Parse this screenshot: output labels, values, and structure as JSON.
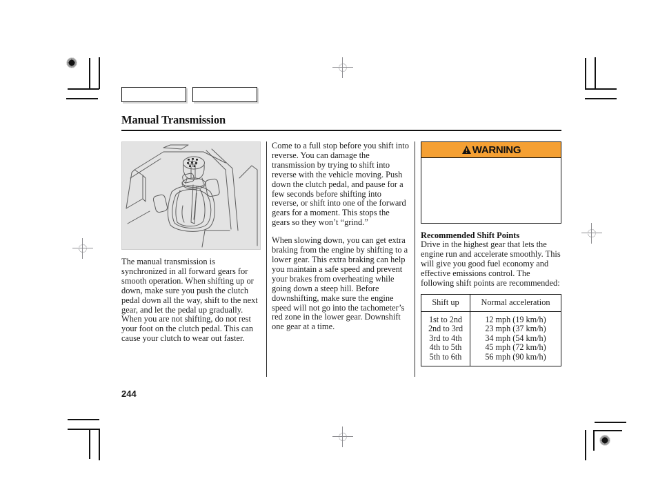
{
  "document": {
    "title": "Manual Transmission",
    "page_number": "244",
    "tabs": [
      {
        "label": ""
      },
      {
        "label": ""
      }
    ]
  },
  "figure": {
    "name": "manual-shift-lever-illustration",
    "alt": "Illustration of a manual transmission shift lever in the center console"
  },
  "left_column": {
    "caption": "The manual transmission is synchronized in all forward gears for smooth operation. When shifting up or down, make sure you push the clutch pedal down all the way, shift to the next gear, and let the pedal up gradually. When you are not shifting, do not rest your foot on the clutch pedal. This can cause your clutch to wear out faster."
  },
  "middle_column": {
    "paragraphs": [
      "Come to a full stop before you shift into reverse. You can damage the transmission by trying to shift into reverse with the vehicle moving. Push down the clutch pedal, and pause for a few seconds before shifting into reverse, or shift into one of the forward gears for a moment. This stops the gears so they won’t “grind.”",
      "When slowing down, you can get extra braking from the engine by shifting to a lower gear. This extra braking can help you maintain a safe speed and prevent your brakes from overheating while going down a steep hill. Before downshifting, make sure the engine speed will not go into the tachometer’s red zone in the lower gear. Downshift one gear at a time."
    ]
  },
  "right_column": {
    "warning": {
      "icon": "warning-triangle-icon",
      "label": "WARNING",
      "body": "",
      "header_color": "#f5a033"
    },
    "shift_points": {
      "heading": "Recommended Shift Points",
      "text": "Drive in the highest gear that lets the engine run and accelerate smoothly. This will give you good fuel economy and effective emissions control. The following shift points are recommended:",
      "table": {
        "headers": [
          "Shift up",
          "Normal acceleration"
        ],
        "rows": [
          [
            "1st to 2nd",
            "12 mph (19 km/h)"
          ],
          [
            "2nd to 3rd",
            "23 mph (37 km/h)"
          ],
          [
            "3rd to 4th",
            "34 mph (54 km/h)"
          ],
          [
            "4th to 5th",
            "45 mph (72 km/h)"
          ],
          [
            "5th to 6th",
            "56 mph (90 km/h)"
          ]
        ]
      }
    }
  }
}
